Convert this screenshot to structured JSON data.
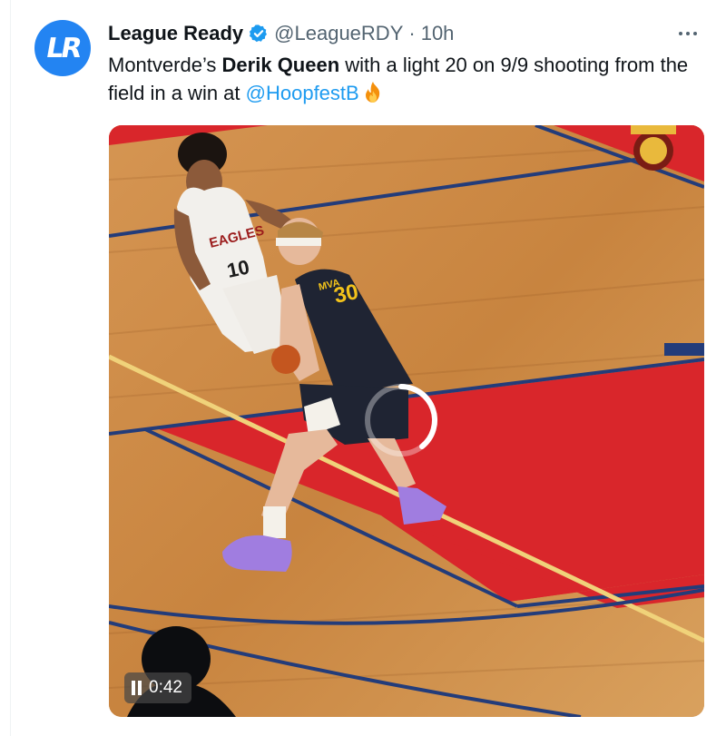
{
  "author": {
    "name": "League Ready",
    "handle": "@LeagueRDY",
    "separator": "·",
    "time": "10h",
    "verified": true,
    "avatar_icon": "league-ready-logo"
  },
  "more_icon": "more-horizontal-icon",
  "tweet": {
    "text_before": "Montverde’s ",
    "text_bold": "Derik Queen",
    "text_after": " with a light 20 on 9/9 shooting from the field in a win at ",
    "mention": "@HoopfestB",
    "emoji": "fire-icon"
  },
  "media": {
    "type": "video",
    "jersey_white_text": "EAGLES",
    "jersey_white_number": "10",
    "jersey_navy_text": "MVA",
    "jersey_navy_number": "30",
    "timer": "0:42",
    "playback_icon": "pause-icon",
    "loading_icon": "spinner-icon",
    "watermark_icon": "hoopfest-logo"
  },
  "colors": {
    "accent": "#1d9bf0",
    "avatar_bg": "#2384f2",
    "text": "#0f1419",
    "muted": "#536471",
    "court_wood": "#c9874a",
    "court_red": "#d9262b",
    "court_blue": "#233c7a"
  }
}
